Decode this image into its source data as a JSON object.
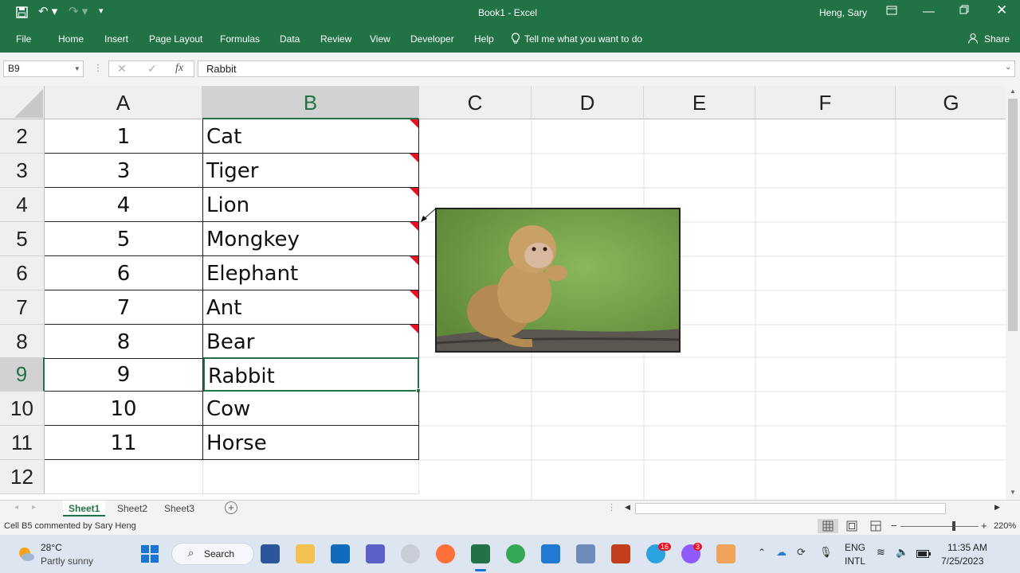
{
  "window": {
    "title": "Book1  -  Excel",
    "user": "Heng, Sary",
    "share": "Share"
  },
  "ribbon": {
    "tabs": [
      "File",
      "Home",
      "Insert",
      "Page Layout",
      "Formulas",
      "Data",
      "Review",
      "View",
      "Developer",
      "Help"
    ],
    "tell_me": "Tell me what you want to do"
  },
  "formula_bar": {
    "name_box": "B9",
    "content": "Rabbit",
    "fx": "fx",
    "cancel": "✕",
    "enter": "✓"
  },
  "columns": [
    "A",
    "B",
    "C",
    "D",
    "E",
    "F",
    "G"
  ],
  "rows": [
    {
      "num": "2",
      "a": "1",
      "b": "Cat"
    },
    {
      "num": "3",
      "a": "3",
      "b": "Tiger"
    },
    {
      "num": "4",
      "a": "4",
      "b": "Lion"
    },
    {
      "num": "5",
      "a": "5",
      "b": "Mongkey"
    },
    {
      "num": "6",
      "a": "6",
      "b": "Elephant"
    },
    {
      "num": "7",
      "a": "7",
      "b": "Ant"
    },
    {
      "num": "8",
      "a": "8",
      "b": "Bear"
    },
    {
      "num": "9",
      "a": "9",
      "b": "Rabbit"
    },
    {
      "num": "10",
      "a": "10",
      "b": "Cow"
    },
    {
      "num": "11",
      "a": "11",
      "b": "Horse"
    },
    {
      "num": "12",
      "a": "",
      "b": ""
    }
  ],
  "sheets": [
    "Sheet1",
    "Sheet2",
    "Sheet3"
  ],
  "status": {
    "text": "Cell B5 commented by Sary Heng",
    "zoom": "220%"
  },
  "taskbar": {
    "weather_temp": "28°C",
    "weather_desc": "Partly sunny",
    "search": "Search",
    "lang1": "ENG",
    "lang2": "INTL",
    "time": "11:35 AM",
    "date": "7/25/2023",
    "badge_messenger": "3",
    "badge_chat": "16"
  },
  "colors": {
    "excel_green": "#217346",
    "comment_red": "#e81123"
  }
}
